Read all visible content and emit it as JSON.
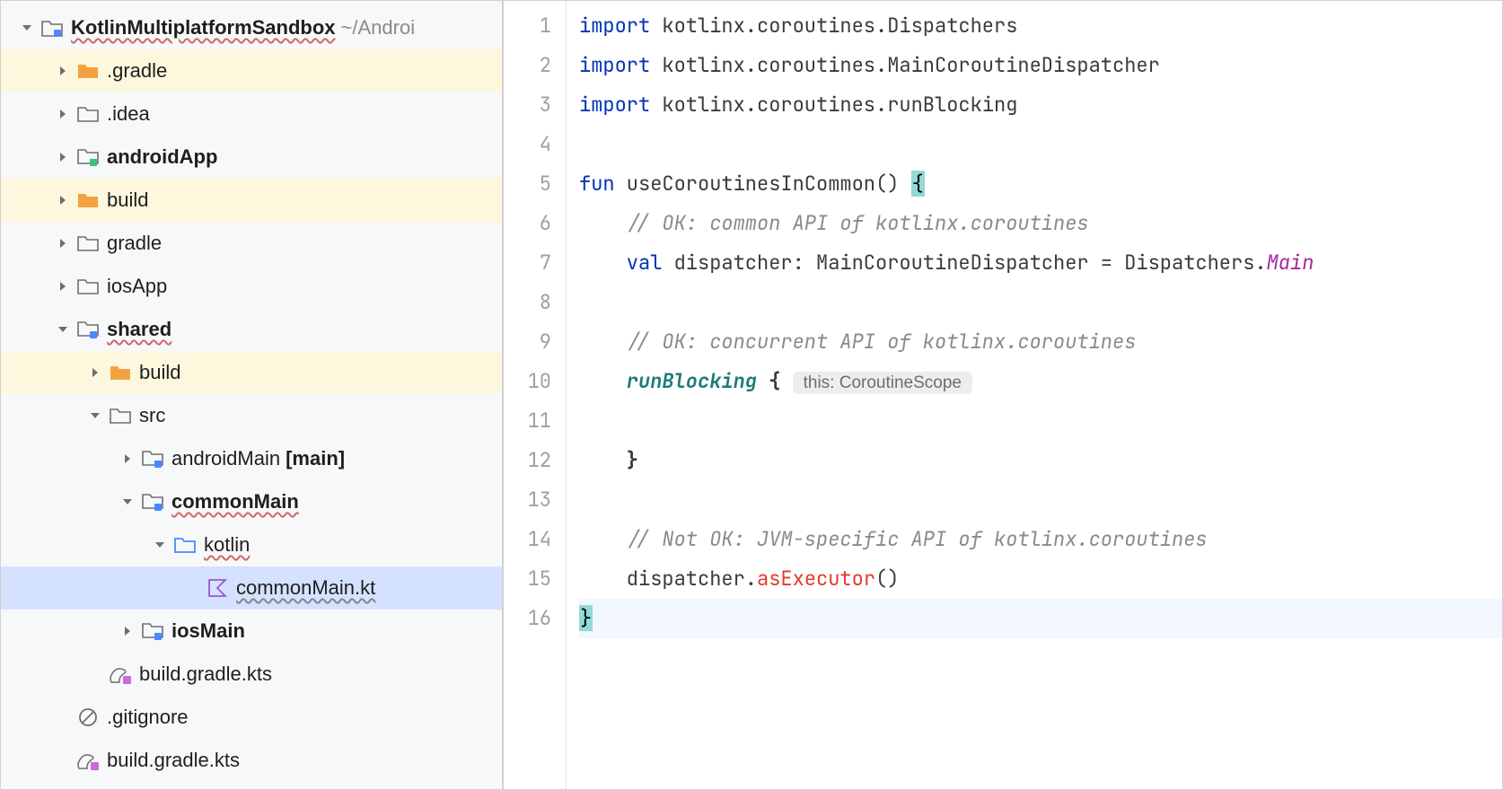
{
  "sidebar": {
    "root": {
      "name": "KotlinMultiplatformSandbox",
      "path": "~/Androi"
    },
    "items": [
      {
        "name": ".gradle"
      },
      {
        "name": ".idea"
      },
      {
        "name": "androidApp"
      },
      {
        "name": "build"
      },
      {
        "name": "gradle"
      },
      {
        "name": "iosApp"
      },
      {
        "name": "shared"
      },
      {
        "name": "build"
      },
      {
        "name": "src"
      },
      {
        "name": "androidMain",
        "suffix": "[main]"
      },
      {
        "name": "commonMain"
      },
      {
        "name": "kotlin"
      },
      {
        "name": "commonMain.kt"
      },
      {
        "name": "iosMain"
      },
      {
        "name": "build.gradle.kts"
      },
      {
        "name": ".gitignore"
      },
      {
        "name": "build.gradle.kts"
      }
    ]
  },
  "editor": {
    "line_count": 16,
    "imports": {
      "kw": "import",
      "l1": " kotlinx.coroutines.Dispatchers",
      "l2": " kotlinx.coroutines.MainCoroutineDispatcher",
      "l3": " kotlinx.coroutines.runBlocking"
    },
    "fn": {
      "kw_fun": "fun",
      "name": " useCoroutinesInCommon() ",
      "brace_open": "{",
      "comment1": "    // OK: common API of kotlinx.coroutines",
      "kw_val": "    val",
      "decl": " dispatcher: MainCoroutineDispatcher = Dispatchers.",
      "main": "Main",
      "comment2": "    // OK: concurrent API of kotlinx.coroutines",
      "runblocking": "    runBlocking ",
      "runblocking_brace": "{",
      "hint": "this: CoroutineScope",
      "inner_close": "    }",
      "comment3": "    // Not OK: JVM-specific API of kotlinx.coroutines",
      "dispatch_call": "    dispatcher.",
      "asExecutor": "asExecutor",
      "paren": "()",
      "brace_close": "}"
    }
  }
}
